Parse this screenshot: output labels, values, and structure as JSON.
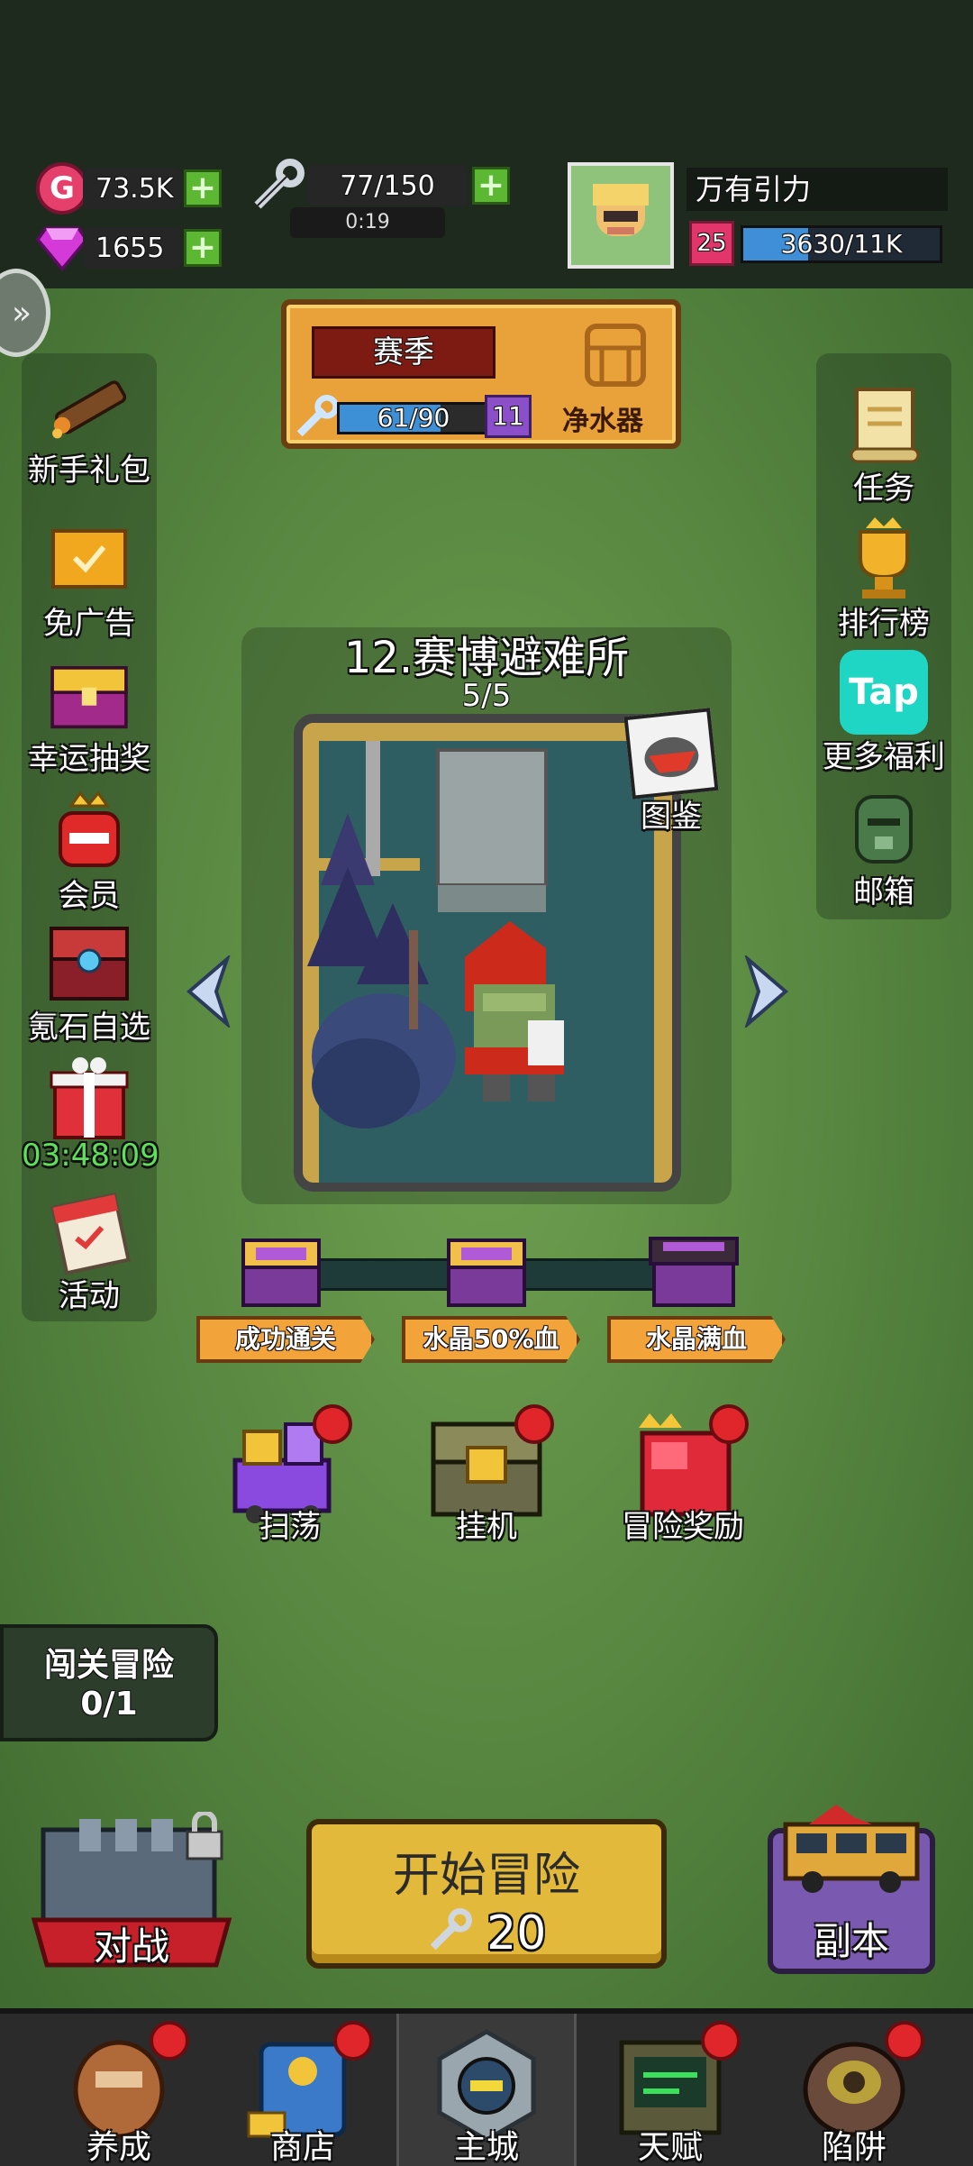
{
  "header": {
    "gold": {
      "value": "73.5K",
      "icon": "gold-coin-icon"
    },
    "gems": {
      "value": "1655",
      "icon": "gem-icon"
    },
    "energy": {
      "value": "77/150",
      "timer": "0:19",
      "icon": "wrench-icon"
    },
    "player": {
      "name": "万有引力",
      "level": "25",
      "xp": "3630/11K",
      "xp_fraction": 0.33
    }
  },
  "season": {
    "title": "赛季",
    "progress": "61/90",
    "progress_fraction": 0.68,
    "level": "11",
    "reward_label": "净水器"
  },
  "left_menu": [
    {
      "label": "新手礼包",
      "icon": "rocket-launcher-icon"
    },
    {
      "label": "免广告",
      "icon": "ticket-icon"
    },
    {
      "label": "幸运抽奖",
      "icon": "treasure-chest-icon"
    },
    {
      "label": "会员",
      "icon": "crown-icon"
    },
    {
      "label": "氪石自选",
      "icon": "ornate-chest-icon"
    },
    {
      "label": "03:48:09",
      "icon": "gift-box-icon"
    },
    {
      "label": "活动",
      "icon": "calendar-icon"
    }
  ],
  "right_menu": [
    {
      "label": "任务",
      "icon": "scroll-icon"
    },
    {
      "label": "排行榜",
      "icon": "trophy-icon"
    },
    {
      "label": "更多福利",
      "icon": "tap-icon",
      "icon_text": "Tap"
    },
    {
      "label": "邮箱",
      "icon": "mailbox-icon"
    }
  ],
  "level": {
    "title": "12.赛博避难所",
    "progress": "5/5",
    "codex_label": "图鉴"
  },
  "milestones": [
    "成功通关",
    "水晶50%血",
    "水晶满血"
  ],
  "actions": [
    {
      "label": "扫荡",
      "icon": "sweep-cart-icon"
    },
    {
      "label": "挂机",
      "icon": "idle-chest-icon"
    },
    {
      "label": "冒险奖励",
      "icon": "reward-box-icon"
    }
  ],
  "adventure": {
    "title": "闯关冒险",
    "count": "0/1"
  },
  "battle_label": "对战",
  "start": {
    "title": "开始冒险",
    "cost": "20"
  },
  "dungeon_label": "副本",
  "nav": [
    {
      "label": "养成",
      "icon": "character-icon"
    },
    {
      "label": "商店",
      "icon": "shop-icon"
    },
    {
      "label": "主城",
      "icon": "main-city-icon"
    },
    {
      "label": "天赋",
      "icon": "talent-terminal-icon"
    },
    {
      "label": "陷阱",
      "icon": "trap-icon"
    }
  ],
  "colors": {
    "accent_green": "#5cb832",
    "timer_green": "#5ee05a",
    "alert_red": "#e0262b",
    "start_yellow": "#e2b93a"
  }
}
